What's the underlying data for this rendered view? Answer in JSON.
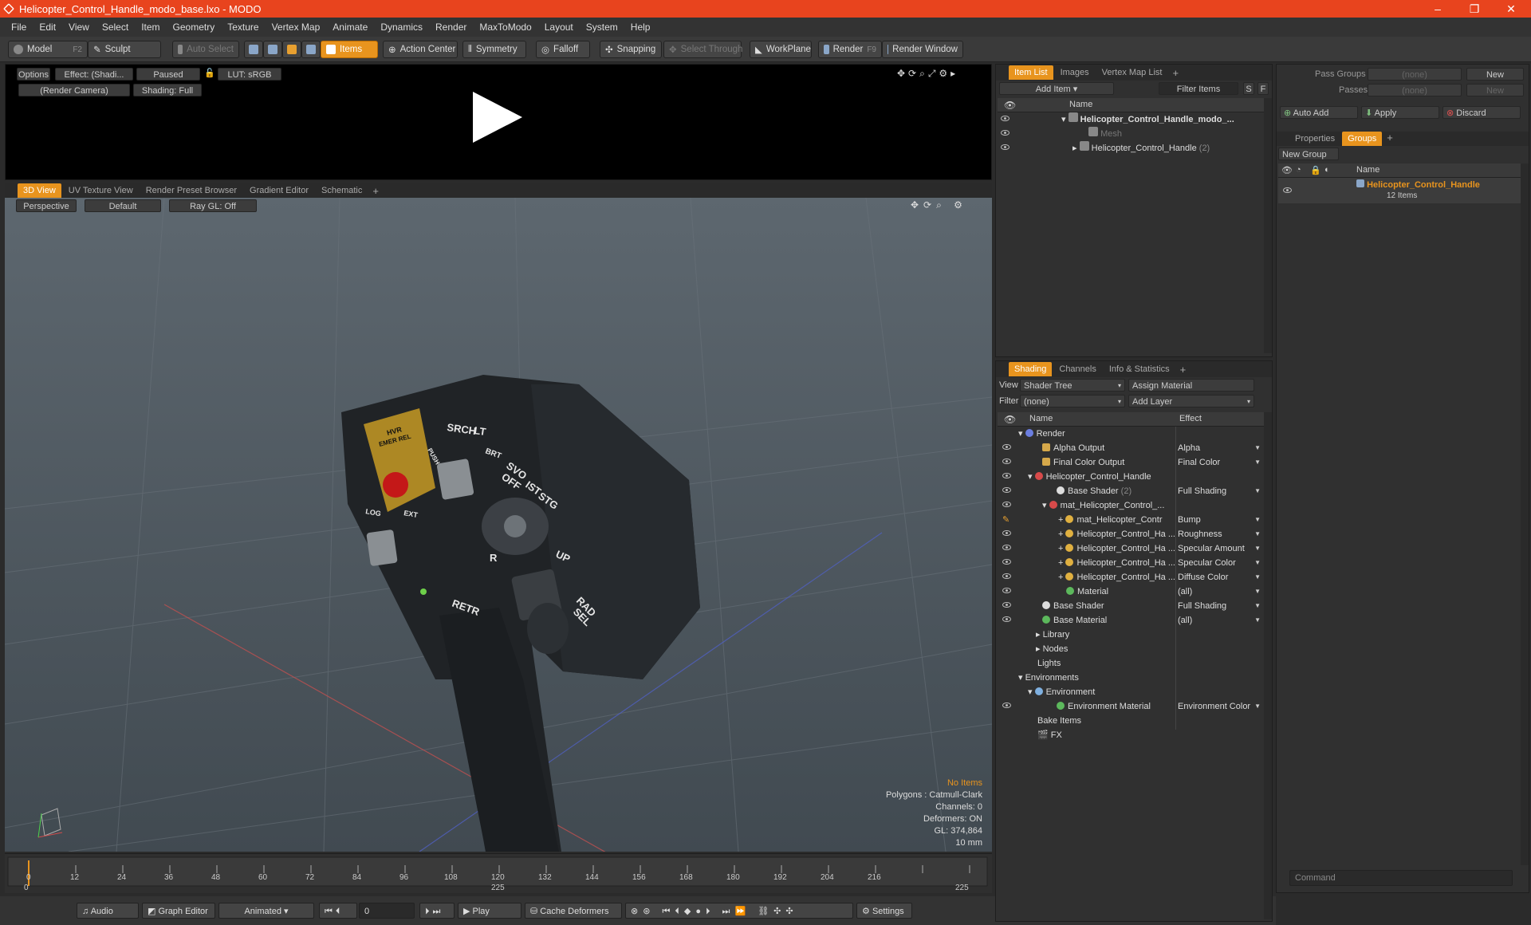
{
  "window": {
    "title": "Helicopter_Control_Handle_modo_base.lxo - MODO",
    "min": "–",
    "max": "❐",
    "close": "✕"
  },
  "menu": [
    "File",
    "Edit",
    "View",
    "Select",
    "Item",
    "Geometry",
    "Texture",
    "Vertex Map",
    "Animate",
    "Dynamics",
    "Render",
    "MaxToModo",
    "Layout",
    "System",
    "Help"
  ],
  "toolbar": {
    "model": "Model",
    "model_key": "F2",
    "sculpt": "Sculpt",
    "auto_select": "Auto Select",
    "items": "Items",
    "action_center": "Action Center",
    "symmetry": "Symmetry",
    "falloff": "Falloff",
    "snapping": "Snapping",
    "select_through": "Select Through",
    "workplane": "WorkPlane",
    "render": "Render",
    "render_key": "F9",
    "render_window": "Render Window"
  },
  "preview": {
    "options": "Options",
    "effect": "Effect: (Shadi...",
    "paused": "Paused",
    "lut": "LUT: sRGB",
    "camera": "(Render Camera)",
    "shading": "Shading: Full"
  },
  "viewport_tabs": [
    "3D View",
    "UV Texture View",
    "Render Preset Browser",
    "Gradient Editor",
    "Schematic"
  ],
  "viewport": {
    "perspective": "Perspective",
    "default": "Default",
    "raygl": "Ray GL: Off",
    "info": {
      "no_items": "No Items",
      "polygons": "Polygons : Catmull-Clark",
      "channels": "Channels: 0",
      "deformers": "Deformers: ON",
      "gl": "GL: 374,864",
      "scale": "10 mm"
    }
  },
  "model_labels": {
    "srch": "SRCH",
    "lt": "LT",
    "brt": "BRT",
    "svo": "SVO",
    "off": "OFF",
    "ist": "IST",
    "stg": "STG",
    "up": "UP",
    "rad": "RAD",
    "sel": "SEL",
    "retr": "RETR",
    "r": "R",
    "hover": "HVR",
    "emer": "EMER REL",
    "push": "PUSH",
    "log": "LOG",
    "ext": "EXT"
  },
  "timeline": {
    "ticks": [
      "0",
      "12",
      "24",
      "36",
      "48",
      "60",
      "72",
      "84",
      "96",
      "108",
      "120",
      "132",
      "144",
      "156",
      "168",
      "180",
      "192",
      "204",
      "216"
    ],
    "start": "0",
    "mid": "225",
    "end": "225"
  },
  "bottom": {
    "audio": "Audio",
    "graph_editor": "Graph Editor",
    "animated": "Animated",
    "frame": "0",
    "play": "Play",
    "cache": "Cache Deformers",
    "settings": "Settings",
    "command": "Command"
  },
  "item_list": {
    "tabs": [
      "Item List",
      "Images",
      "Vertex Map List"
    ],
    "add_item": "Add Item",
    "filter": "Filter Items",
    "s": "S",
    "f": "F",
    "col_name": "Name",
    "items": [
      {
        "label": "Helicopter_Control_Handle_modo_..."
      },
      {
        "label": "Mesh"
      },
      {
        "label": "Helicopter_Control_Handle",
        "count": "(2)"
      }
    ]
  },
  "shading": {
    "tabs": [
      "Shading",
      "Channels",
      "Info & Statistics"
    ],
    "view_label": "View",
    "view_value": "Shader Tree",
    "assign": "Assign Material",
    "filter_label": "Filter",
    "filter_value": "(none)",
    "add_layer": "Add Layer",
    "col_name": "Name",
    "col_effect": "Effect",
    "rows": [
      {
        "label": "Render",
        "effect": "",
        "color": "#6b7ee0"
      },
      {
        "label": "Alpha Output",
        "effect": "Alpha",
        "color": "#d6a84a"
      },
      {
        "label": "Final Color Output",
        "effect": "Final Color",
        "color": "#d6a84a"
      },
      {
        "label": "Helicopter_Control_Handle",
        "effect": "",
        "color": "#d84a4a"
      },
      {
        "label": "Base Shader",
        "count": "(2)",
        "effect": "Full Shading",
        "color": "#dddddd"
      },
      {
        "label": "mat_Helicopter_Control_...",
        "effect": "",
        "color": "#d84a4a"
      },
      {
        "label": "mat_Helicopter_Contr",
        "effect": "Bump",
        "color": "#e0b040"
      },
      {
        "label": "Helicopter_Control_Ha ...",
        "effect": "Roughness",
        "color": "#e0b040"
      },
      {
        "label": "Helicopter_Control_Ha ...",
        "effect": "Specular Amount",
        "color": "#e0b040"
      },
      {
        "label": "Helicopter_Control_Ha ...",
        "effect": "Specular Color",
        "color": "#e0b040"
      },
      {
        "label": "Helicopter_Control_Ha ...",
        "effect": "Diffuse Color",
        "color": "#e0b040"
      },
      {
        "label": "Material",
        "effect": "(all)",
        "color": "#5cb85c"
      },
      {
        "label": "Base Shader",
        "effect": "Full Shading",
        "color": "#dddddd"
      },
      {
        "label": "Base Material",
        "effect": "(all)",
        "color": "#5cb85c"
      },
      {
        "label": "Library",
        "effect": ""
      },
      {
        "label": "Nodes",
        "effect": ""
      },
      {
        "label": "Lights",
        "effect": ""
      },
      {
        "label": "Environments",
        "effect": ""
      },
      {
        "label": "Environment",
        "effect": "",
        "color": "#7fb0e0"
      },
      {
        "label": "Environment Material",
        "effect": "Environment Color",
        "color": "#5cb85c"
      },
      {
        "label": "Bake Items",
        "effect": ""
      },
      {
        "label": "FX",
        "effect": ""
      }
    ]
  },
  "groups": {
    "pass_groups": "Pass Groups",
    "passes": "Passes",
    "none": "(none)",
    "new": "New",
    "auto_add": "Auto Add",
    "apply": "Apply",
    "discard": "Discard",
    "tabs": [
      "Properties",
      "Groups"
    ],
    "new_group": "New Group",
    "col_name": "Name",
    "group_name": "Helicopter_Control_Handle",
    "group_items": "12 Items"
  }
}
